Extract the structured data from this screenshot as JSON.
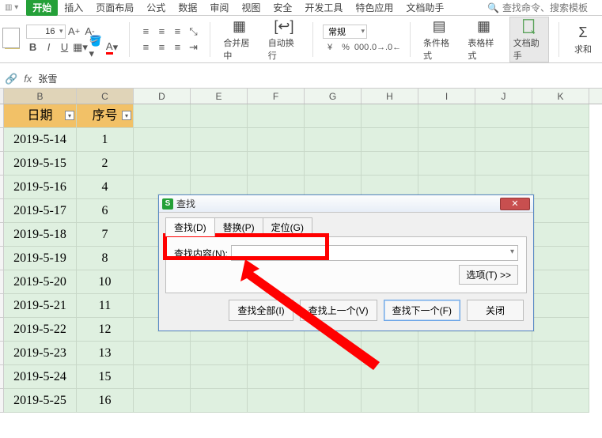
{
  "tabs": {
    "items": [
      "开始",
      "插入",
      "页面布局",
      "公式",
      "数据",
      "审阅",
      "视图",
      "安全",
      "开发工具",
      "特色应用",
      "文档助手"
    ],
    "active_index": 0,
    "search_icon_title": "查找",
    "search_placeholder": "查找命令、搜索模板"
  },
  "ribbon": {
    "font_size": "16",
    "A_upper": "A⁺",
    "A_lower": "A⁻",
    "B": "B",
    "I": "I",
    "U": "U",
    "merge_label": "合并居中",
    "wrap_label": "自动换行",
    "numfmt": "常规",
    "currency": "¥",
    "percent": "%",
    "comma": "000",
    "incdec1": ".0↑",
    "incdec2": ".0↓",
    "condfmt": "条件格式",
    "tablestyle": "表格样式",
    "docassist": "文档助手",
    "sum": "求和"
  },
  "formula_bar": {
    "fx": "fx",
    "value": "张雪"
  },
  "columns": [
    "B",
    "C",
    "D",
    "E",
    "F",
    "G",
    "H",
    "I",
    "J",
    "K"
  ],
  "headers": {
    "B": "日期",
    "C": "序号"
  },
  "rows": [
    {
      "date": "2019-5-14",
      "seq": "1"
    },
    {
      "date": "2019-5-15",
      "seq": "2"
    },
    {
      "date": "2019-5-16",
      "seq": "4"
    },
    {
      "date": "2019-5-17",
      "seq": "6"
    },
    {
      "date": "2019-5-18",
      "seq": "7"
    },
    {
      "date": "2019-5-19",
      "seq": "8"
    },
    {
      "date": "2019-5-20",
      "seq": "10"
    },
    {
      "date": "2019-5-21",
      "seq": "11"
    },
    {
      "date": "2019-5-22",
      "seq": "12"
    },
    {
      "date": "2019-5-23",
      "seq": "13"
    },
    {
      "date": "2019-5-24",
      "seq": "15"
    },
    {
      "date": "2019-5-25",
      "seq": "16"
    }
  ],
  "dialog": {
    "title": "查找",
    "tabs": [
      "查找(D)",
      "替换(P)",
      "定位(G)"
    ],
    "active_tab": 0,
    "find_label": "查找内容(N):",
    "options_btn": "选项(T) >>",
    "buttons": {
      "find_all": "查找全部(I)",
      "find_prev": "查找上一个(V)",
      "find_next": "查找下一个(F)",
      "close": "关闭"
    }
  }
}
